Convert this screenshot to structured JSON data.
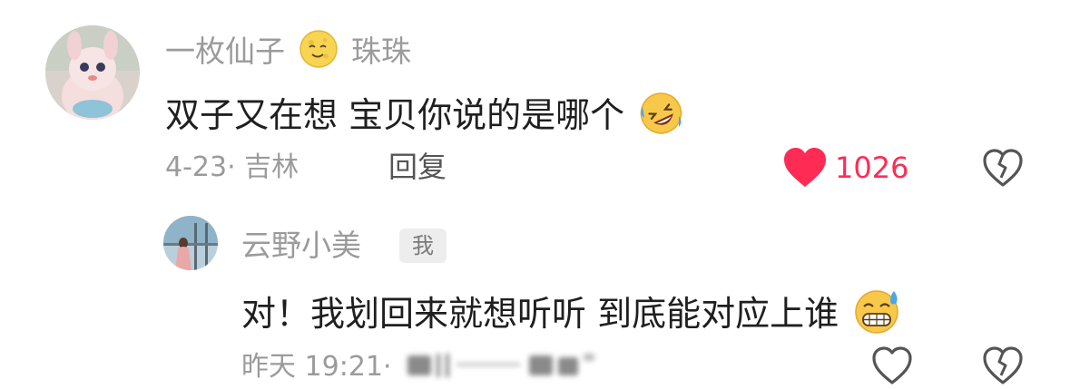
{
  "comment": {
    "username_part1": "一枚仙子",
    "username_emoji": "moon-face-emoji",
    "username_part2": "珠珠",
    "text": "双子又在想 宝贝你说的是哪个",
    "text_emoji": "rolling-laughing-emoji",
    "date_location": "4-23· 吉林",
    "reply_label": "回复",
    "like_count": "1026",
    "liked": true
  },
  "reply": {
    "username": "云野小美",
    "badge": "我",
    "text": "对！我划回来就想听听 到底能对应上谁",
    "text_emoji": "grinning-sweat-emoji",
    "time_prefix": "昨天 19:21·"
  },
  "colors": {
    "like_red": "#fe2c55",
    "meta_gray": "#9b9b9b",
    "icon_gray": "#555555"
  }
}
